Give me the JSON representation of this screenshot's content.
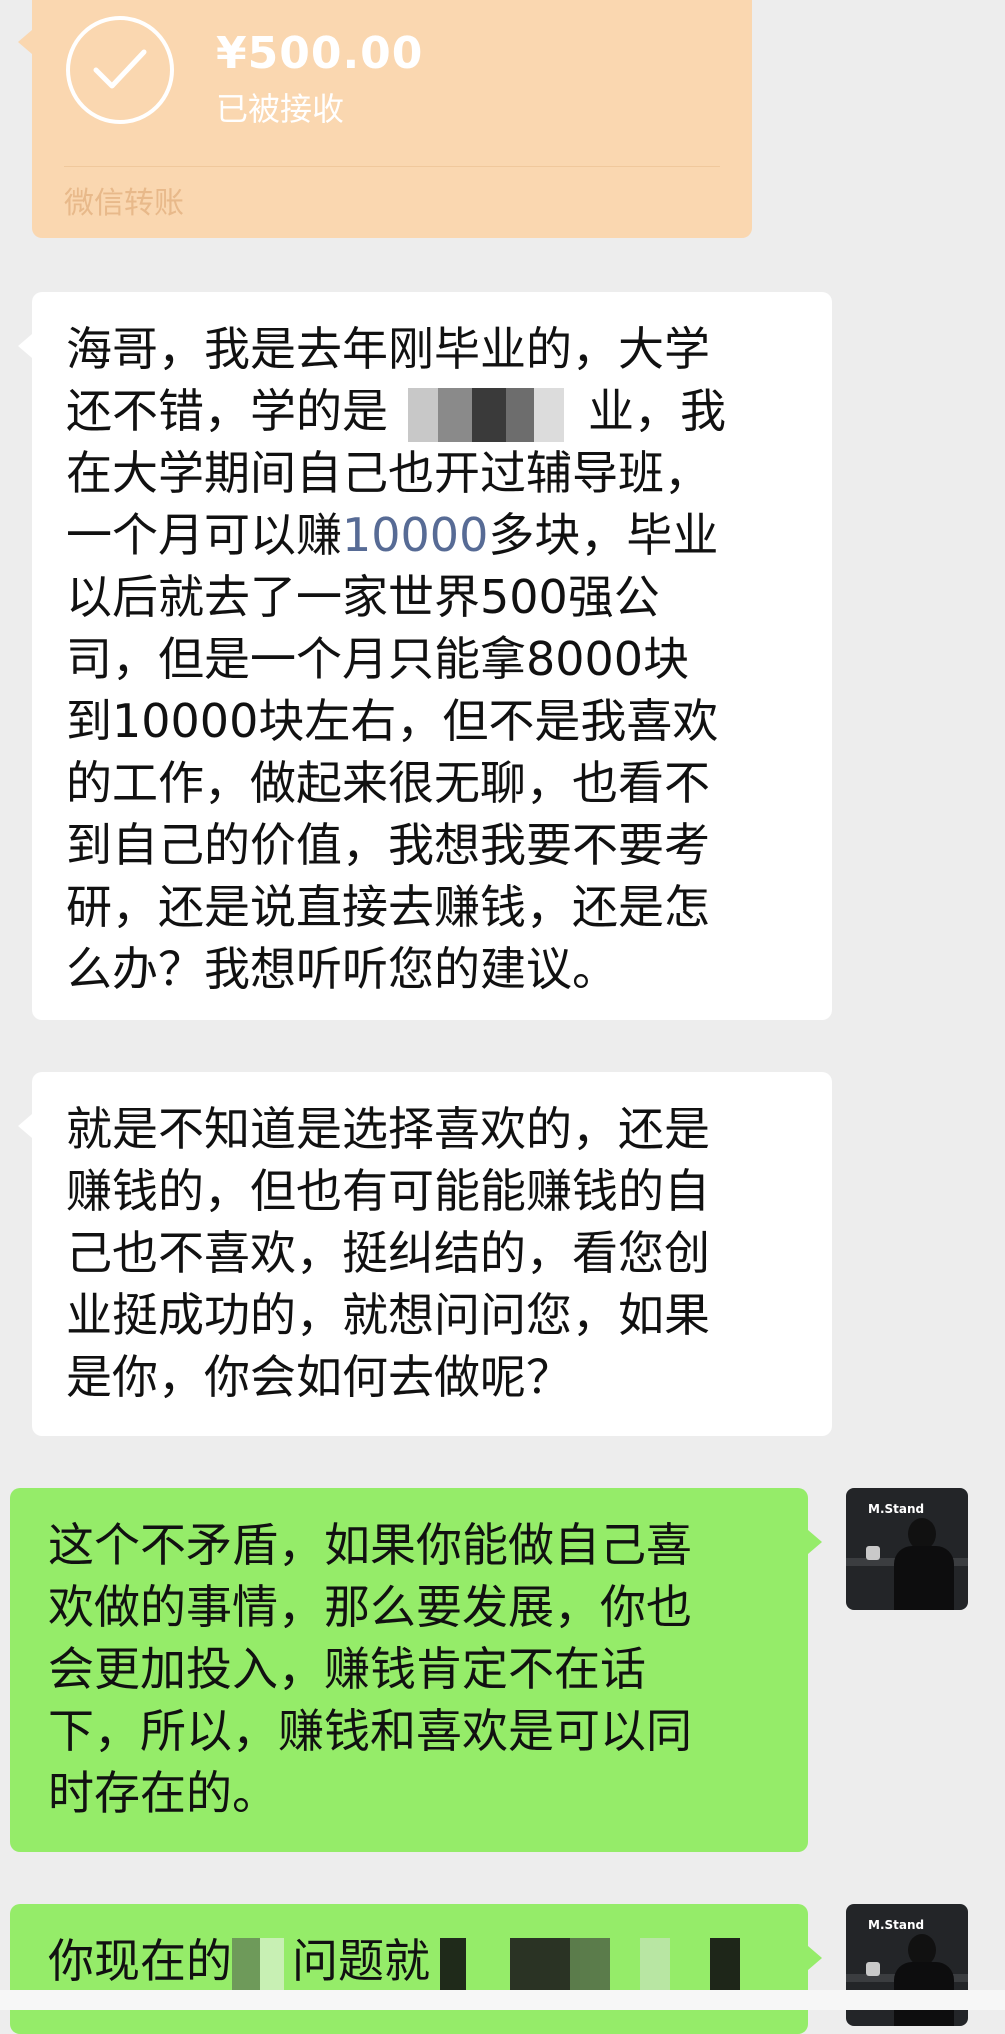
{
  "transfer": {
    "amount": "¥500.00",
    "status": "已被接收",
    "label": "微信转账",
    "icon": "check-circle-icon",
    "color": "#fad7b0"
  },
  "messages": [
    {
      "side": "left",
      "lines": [
        "海哥，我是去年刚毕业的，大学",
        "还不错，学的是",
        "在大学期间自己也开过辅导班，",
        "一个月可以赚",
        "以后就去了一家世界500强公",
        "司，但是一个月只能拿8000块",
        "到10000块左右，但不是我喜欢",
        "的工作，做起来很无聊，也看不",
        "到自己的价值，我想我要不要考",
        "研，还是说直接去赚钱，还是怎",
        "么办？我想听听您的建议。"
      ],
      "line2_suffix": "业，我",
      "line4_number": "10000",
      "line4_suffix": "多块，毕业"
    },
    {
      "side": "left",
      "lines": [
        "就是不知道是选择喜欢的，还是",
        "赚钱的，但也有可能能赚钱的自",
        "己也不喜欢，挺纠结的，看您创",
        "业挺成功的，就想问问您，如果",
        "是你，你会如何去做呢？"
      ]
    },
    {
      "side": "right",
      "lines": [
        "这个不矛盾，如果你能做自己喜",
        "欢做的事情，那么要发展，你也",
        "会更加投入，赚钱肯定不在话",
        "下，所以，赚钱和喜欢是可以同",
        "时存在的。"
      ]
    },
    {
      "side": "right",
      "lines": [
        "你现在的",
        "问题就"
      ]
    }
  ],
  "avatar": {
    "sign_text": "M.Stand",
    "icon": "user-avatar"
  },
  "colors": {
    "background": "#ededed",
    "bubble_left": "#ffffff",
    "bubble_right": "#95ec69",
    "number_highlight": "#576b95"
  }
}
